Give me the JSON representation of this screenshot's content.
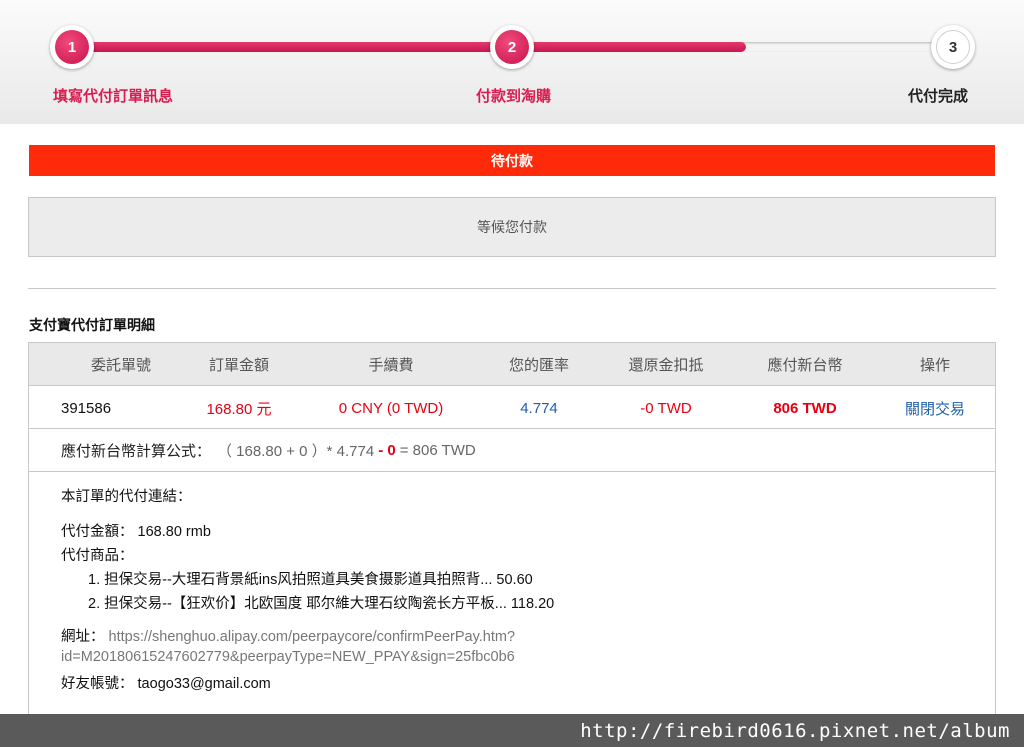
{
  "steps": [
    {
      "number": "1",
      "label": "填寫代付訂單訊息",
      "state": "done"
    },
    {
      "number": "2",
      "label": "付款到淘購",
      "state": "current"
    },
    {
      "number": "3",
      "label": "代付完成",
      "state": "pending"
    }
  ],
  "progress_fraction": 0.76,
  "status": {
    "label": "待付款",
    "wait_message": "等候您付款"
  },
  "section_title": "支付寶代付訂單明細",
  "table": {
    "headers": [
      "委託單號",
      "訂單金額",
      "手續費",
      "您的匯率",
      "還原金扣抵",
      "應付新台幣",
      "操作"
    ],
    "row": {
      "order_no": "391586",
      "amount": "168.80 元",
      "fee": "0 CNY (0 TWD)",
      "rate": "4.774",
      "rebate": "-0 TWD",
      "twd_due": "806 TWD",
      "action": "關閉交易"
    }
  },
  "formula": {
    "label": "應付新台幣計算公式：",
    "expr_start": "（ 168.80 + 0 ）* 4.774",
    "minus": "- 0",
    "result": "= 806 TWD"
  },
  "link_info": {
    "heading": "本訂單的代付連結：",
    "amount_label": "代付金額：",
    "amount_value": "168.80 rmb",
    "items_label": "代付商品：",
    "items": [
      "1. 担保交易--大理石背景紙ins风拍照道具美食摄影道具拍照背... 50.60",
      "2. 担保交易--【狂欢价】北欧国度 耶尔維大理石纹陶瓷长方平板... 118.20"
    ],
    "url_label": "網址：",
    "url_line1": "https://shenghuo.alipay.com/peerpaycore/confirmPeerPay.htm?",
    "url_line2": "id=M20180615247602779&peerpayType=NEW_PPAY&sign=25fbc0b6",
    "friend_label": "好友帳號：",
    "friend_value": "taogo33@gmail.com"
  },
  "watermark": "http://firebird0616.pixnet.net/album",
  "colors": {
    "accent": "#d81e50",
    "status_red": "#ff2a0a",
    "link_blue": "#1f5fa8"
  }
}
